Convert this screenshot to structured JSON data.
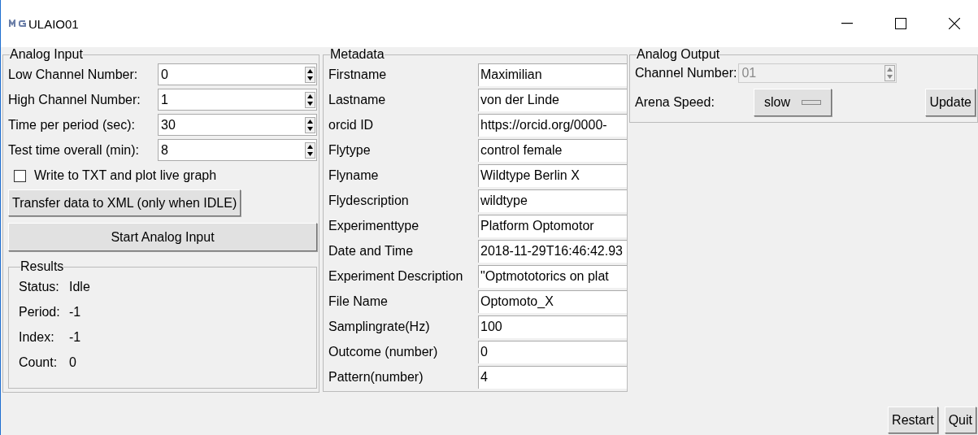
{
  "window": {
    "title": "ULAIO01"
  },
  "analog_input": {
    "title": "Analog Input",
    "fields": [
      {
        "label": "Low Channel Number:",
        "value": "0"
      },
      {
        "label": "High Channel Number:",
        "value": "1"
      },
      {
        "label": "Time per period (sec):",
        "value": "30"
      },
      {
        "label": "Test time overall (min):",
        "value": "8"
      }
    ],
    "checkbox": {
      "label": "Write to TXT and plot live graph",
      "checked": false
    },
    "transfer_button": "Transfer data to XML (only when IDLE)",
    "start_button": "Start Analog Input",
    "results": {
      "title": "Results",
      "rows": [
        {
          "label": "Status:",
          "value": "Idle"
        },
        {
          "label": "Period:",
          "value": "-1"
        },
        {
          "label": "Index:",
          "value": "-1"
        },
        {
          "label": "Count:",
          "value": "0"
        }
      ]
    }
  },
  "metadata": {
    "title": "Metadata",
    "fields": [
      {
        "label": "Firstname",
        "value": "Maximilian"
      },
      {
        "label": "Lastname",
        "value": "von der Linde"
      },
      {
        "label": "orcid ID",
        "value": "https://orcid.org/0000-"
      },
      {
        "label": "Flytype",
        "value": "control female"
      },
      {
        "label": "Flyname",
        "value": "Wildtype Berlin X"
      },
      {
        "label": "Flydescription",
        "value": "wildtype"
      },
      {
        "label": "Experimenttype",
        "value": "Platform Optomotor"
      },
      {
        "label": "Date and Time",
        "value": "2018-11-29T16:46:42.93"
      },
      {
        "label": "Experiment Description",
        "value": "\"Optmototorics on plat"
      },
      {
        "label": "File Name",
        "value": "Optomoto_X"
      },
      {
        "label": "Samplingrate(Hz)",
        "value": "100"
      },
      {
        "label": "Outcome (number)",
        "value": "0"
      },
      {
        "label": "Pattern(number)",
        "value": "4"
      }
    ]
  },
  "analog_output": {
    "title": "Analog Output",
    "channel": {
      "label": "Channel Number:",
      "value": "01",
      "disabled": true
    },
    "speed": {
      "label": "Arena Speed:",
      "value": "slow"
    },
    "update_button": "Update"
  },
  "buttons": [
    "Restart",
    "Quit"
  ]
}
